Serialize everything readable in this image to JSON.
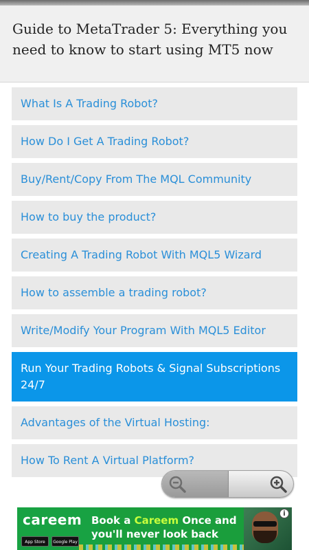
{
  "header": {
    "title": "Guide to MetaTrader 5: Everything you need to know to start using MT5 now"
  },
  "toc": {
    "items": [
      {
        "label": "What Is A Trading Robot?",
        "active": false
      },
      {
        "label": "How Do I Get A Trading Robot?",
        "active": false
      },
      {
        "label": "Buy/Rent/Copy From The MQL Community",
        "active": false
      },
      {
        "label": "How to buy the product?",
        "active": false
      },
      {
        "label": "Creating A Trading Robot With MQL5 Wizard",
        "active": false
      },
      {
        "label": "How to assemble a trading robot?",
        "active": false
      },
      {
        "label": "Write/Modify Your Program With MQL5 Editor",
        "active": false
      },
      {
        "label": "Run Your Trading Robots & Signal Subscriptions 24/7",
        "active": true
      },
      {
        "label": "Advantages of the Virtual Hosting:",
        "active": false
      },
      {
        "label": "How To Rent A Virtual Platform?",
        "active": false
      }
    ]
  },
  "zoom": {
    "out_icon": "zoom-out-icon",
    "in_icon": "zoom-in-icon"
  },
  "ad": {
    "brand": "careem",
    "headline_pre": "Book a ",
    "headline_brand": "Careem",
    "headline_post": " Once and you'll never look back",
    "badge_app_store": "App Store",
    "badge_google_play": "Google Play",
    "info_icon": "info-icon"
  },
  "colors": {
    "link": "#2a8fd8",
    "active_bg": "#0b96e9",
    "item_bg": "#e9e9e9",
    "header_bg": "#f0f0f0",
    "ad_green": "#1a9e3c",
    "ad_highlight": "#c8ff3c"
  }
}
